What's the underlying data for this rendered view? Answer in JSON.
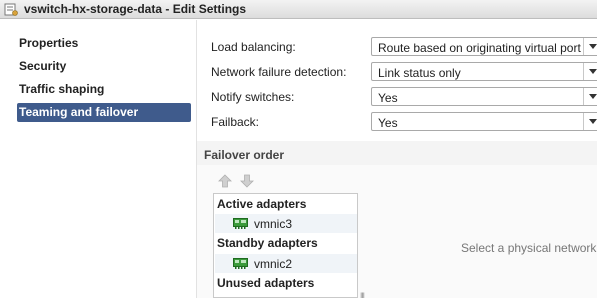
{
  "window": {
    "title": "vswitch-hx-storage-data - Edit Settings",
    "icon": "settings-window-icon"
  },
  "sidebar": {
    "items": [
      {
        "label": "Properties",
        "active": false
      },
      {
        "label": "Security",
        "active": false
      },
      {
        "label": "Traffic shaping",
        "active": false
      },
      {
        "label": "Teaming and failover",
        "active": true
      }
    ]
  },
  "form": {
    "load_balancing": {
      "label": "Load balancing:",
      "value": "Route based on originating virtual port"
    },
    "network_failure_detection": {
      "label": "Network failure detection:",
      "value": "Link status only"
    },
    "notify_switches": {
      "label": "Notify switches:",
      "value": "Yes"
    },
    "failback": {
      "label": "Failback:",
      "value": "Yes"
    }
  },
  "failover": {
    "header": "Failover order",
    "move_up_icon": "arrow-up-icon",
    "move_down_icon": "arrow-down-icon",
    "groups": {
      "active": {
        "label": "Active adapters",
        "adapters": [
          "vmnic3"
        ]
      },
      "standby": {
        "label": "Standby adapters",
        "adapters": [
          "vmnic2"
        ]
      },
      "unused": {
        "label": "Unused adapters",
        "adapters": []
      }
    },
    "placeholder": "Select a physical network ad"
  },
  "colors": {
    "active_nav": "#3f5b8c",
    "nic_green": "#3b9a3b"
  }
}
